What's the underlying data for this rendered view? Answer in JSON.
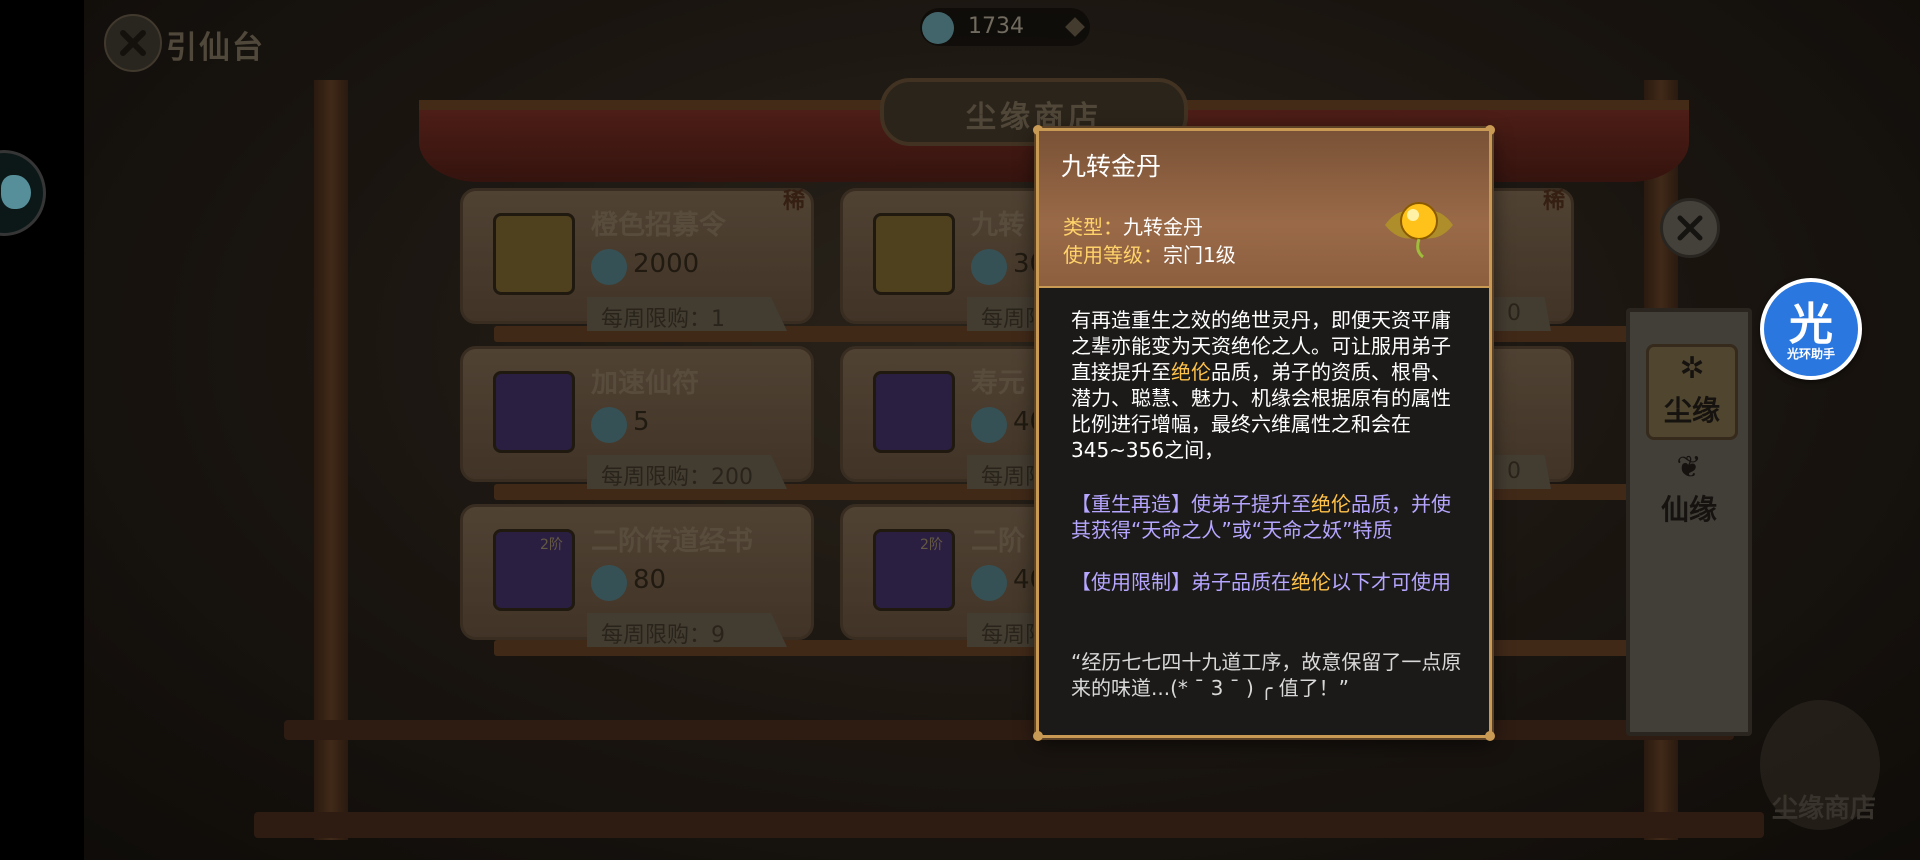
{
  "header": {
    "back_title": "引仙台",
    "currency_value": "1734"
  },
  "shop": {
    "sign": "尘缘商店",
    "cards": [
      {
        "name": "橙色招募令",
        "price": "2000",
        "limit": "每周限购：1",
        "rare": "稀",
        "tier": ""
      },
      {
        "name": "九转",
        "price": "30",
        "limit": "每周限",
        "rare": "",
        "tier": ""
      },
      {
        "name": "",
        "price": "",
        "limit": "0",
        "rare": "稀",
        "tier": ""
      },
      {
        "name": "加速仙符",
        "price": "5",
        "limit": "每周限购：200",
        "rare": "",
        "tier": ""
      },
      {
        "name": "寿元",
        "price": "40",
        "limit": "每周限",
        "rare": "",
        "tier": ""
      },
      {
        "name": "",
        "price": "",
        "limit": "0",
        "rare": "",
        "tier": ""
      },
      {
        "name": "二阶传道经书",
        "price": "80",
        "limit": "每周限购：9",
        "rare": "",
        "tier": "2阶"
      },
      {
        "name": "二阶",
        "price": "40",
        "limit": "每周限",
        "rare": "",
        "tier": "2阶"
      }
    ]
  },
  "side_tabs": {
    "tab1": "尘缘",
    "tab2": "仙缘"
  },
  "corner_label": "尘缘商店",
  "helper": {
    "big": "光",
    "small": "光环助手"
  },
  "tooltip": {
    "title": "九转金丹",
    "type_label": "类型：",
    "type_value": "九转金丹",
    "level_label": "使用等级：",
    "level_value": "宗门1级",
    "desc_1": "有再造重生之效的绝世灵丹，即便天资平庸之辈亦能变为天资绝伦之人。可让服用弟子直接提升至",
    "desc_hl": "绝伦",
    "desc_2": "品质，弟子的资质、根骨、潜力、聪慧、魅力、机缘会根据原有的属性比例进行增幅，最终六维属性之和会在345~356之间，",
    "effect_1a": "【重生再造】使弟子提升至",
    "effect_1hl": "绝伦",
    "effect_1b": "品质，并使其获得“天命之人”或“天命之妖”特质",
    "effect_2a": "【使用限制】弟子品质在",
    "effect_2hl": "绝伦",
    "effect_2b": "以下才可使用",
    "quote": "“经历七七四十九道工序，故意保留了一点原来的味道...(* ˉ 3 ˉ ) ╭ 值了！”"
  },
  "colors": {
    "tooltip_border": "#c99a54",
    "highlight": "#ffc24a",
    "effect_text": "#b6a6ff",
    "label_yellow": "#ffd36a",
    "helper_blue": "#2a77e0"
  },
  "icons": [
    "close-icon",
    "spirit-stone-icon",
    "golden-pill-icon",
    "plus-icon"
  ]
}
